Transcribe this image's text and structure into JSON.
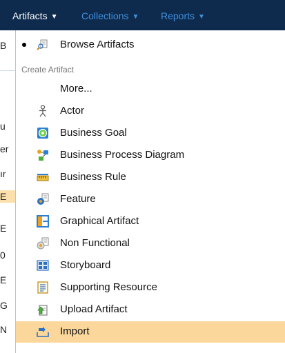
{
  "nav": {
    "artifacts": "Artifacts",
    "collections": "Collections",
    "reports": "Reports",
    "chevron": "⌄"
  },
  "background_page": {
    "letters": [
      "B",
      "",
      "u",
      "er",
      "ır",
      "E",
      "E",
      "0",
      "E",
      "G",
      "N"
    ]
  },
  "dropdown": {
    "browse_label": "Browse Artifacts",
    "section_label": "Create Artifact",
    "more_label": "More...",
    "items": [
      {
        "label": "Actor",
        "icon": "actor-icon"
      },
      {
        "label": "Business Goal",
        "icon": "business-goal-icon"
      },
      {
        "label": "Business Process Diagram",
        "icon": "business-process-diagram-icon"
      },
      {
        "label": "Business Rule",
        "icon": "business-rule-icon"
      },
      {
        "label": "Feature",
        "icon": "feature-icon"
      },
      {
        "label": "Graphical Artifact",
        "icon": "graphical-artifact-icon"
      },
      {
        "label": "Non Functional",
        "icon": "non-functional-icon"
      },
      {
        "label": "Storyboard",
        "icon": "storyboard-icon"
      },
      {
        "label": "Supporting Resource",
        "icon": "supporting-resource-icon"
      },
      {
        "label": "Upload Artifact",
        "icon": "upload-artifact-icon"
      },
      {
        "label": "Import",
        "icon": "import-icon"
      }
    ],
    "highlighted": "Import"
  },
  "colors": {
    "topbar": "#0e2b4d",
    "nav_active": "#ffffff",
    "nav_inactive": "#3f8fe0",
    "highlight": "#fbd79b"
  }
}
